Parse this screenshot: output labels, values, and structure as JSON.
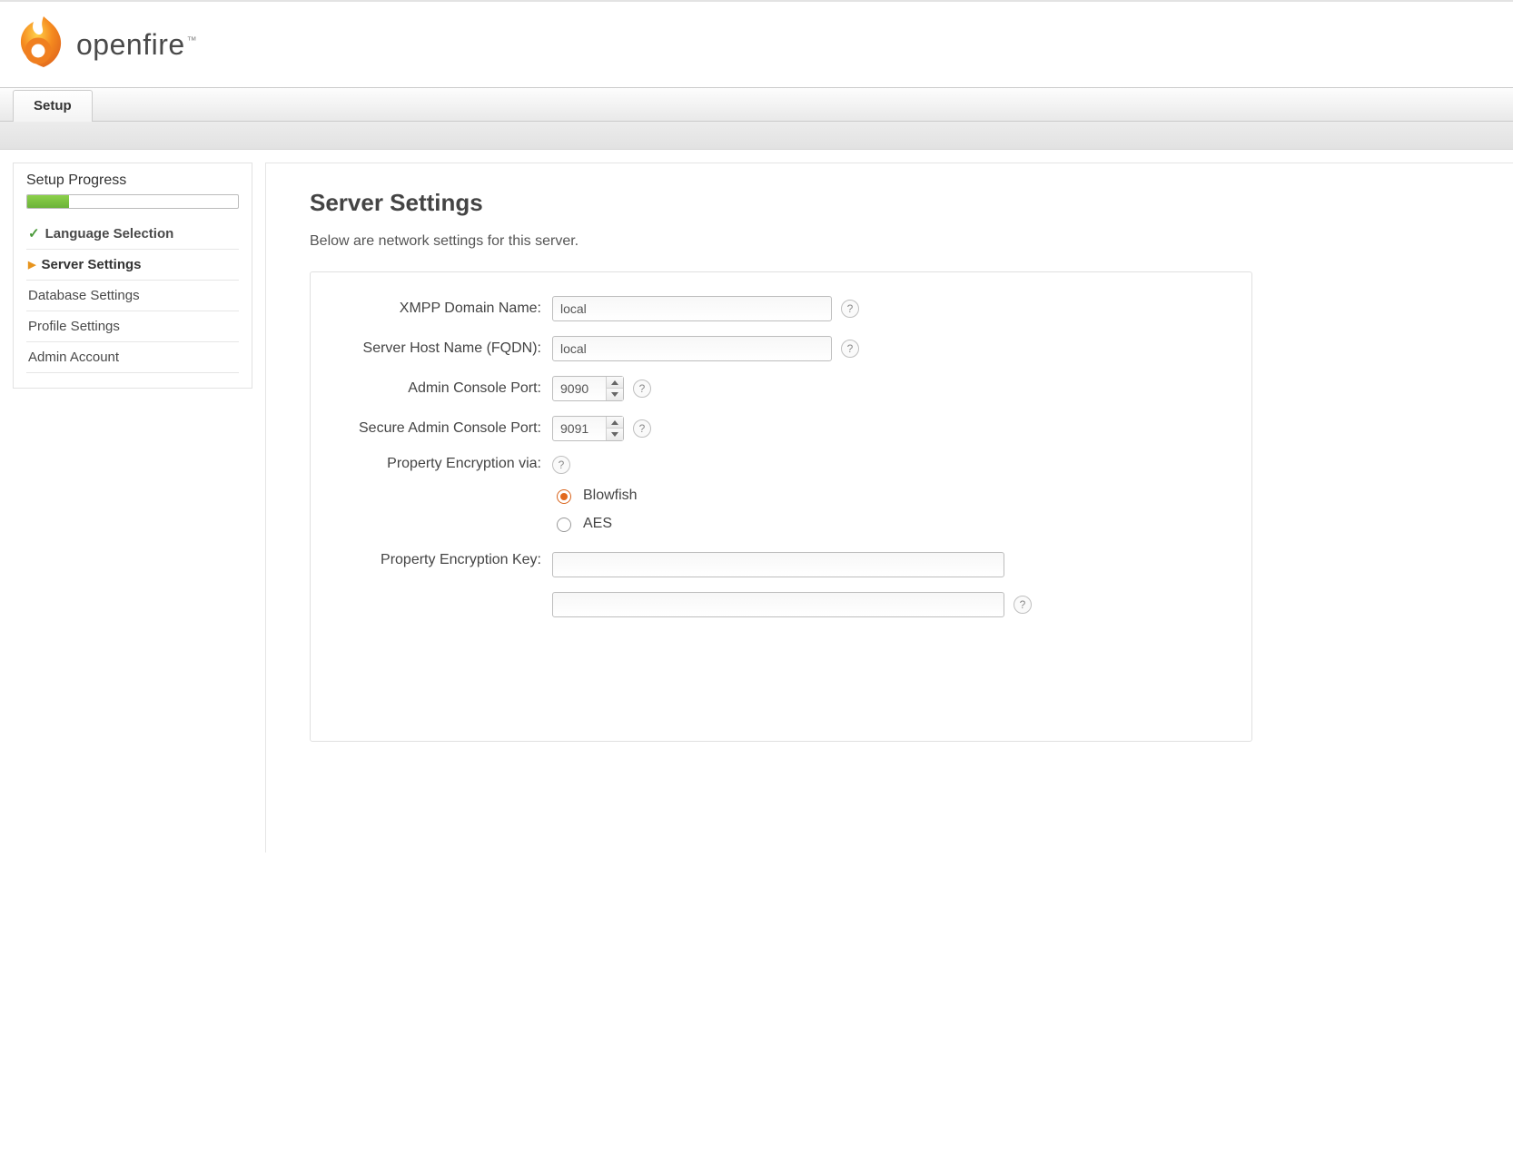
{
  "brand": {
    "name": "openfire",
    "tm": "™"
  },
  "tab": {
    "label": "Setup"
  },
  "sidebar": {
    "title": "Setup Progress",
    "progress_percent": 20,
    "items": [
      {
        "label": "Language Selection",
        "state": "done"
      },
      {
        "label": "Server Settings",
        "state": "current"
      },
      {
        "label": "Database Settings",
        "state": "pending"
      },
      {
        "label": "Profile Settings",
        "state": "pending"
      },
      {
        "label": "Admin Account",
        "state": "pending"
      }
    ]
  },
  "page": {
    "title": "Server Settings",
    "lead": "Below are network settings for this server."
  },
  "form": {
    "domain": {
      "label": "XMPP Domain Name:",
      "value": "local"
    },
    "hostname": {
      "label": "Server Host Name (FQDN):",
      "value": "local"
    },
    "admin_port": {
      "label": "Admin Console Port:",
      "value": "9090"
    },
    "secure_port": {
      "label": "Secure Admin Console Port:",
      "value": "9091"
    },
    "enc_via": {
      "label": "Property Encryption via:",
      "options": {
        "blowfish": "Blowfish",
        "aes": "AES"
      },
      "selected": "blowfish"
    },
    "enc_key": {
      "label": "Property Encryption Key:",
      "value1": "",
      "value2": ""
    },
    "help_glyph": "?"
  }
}
